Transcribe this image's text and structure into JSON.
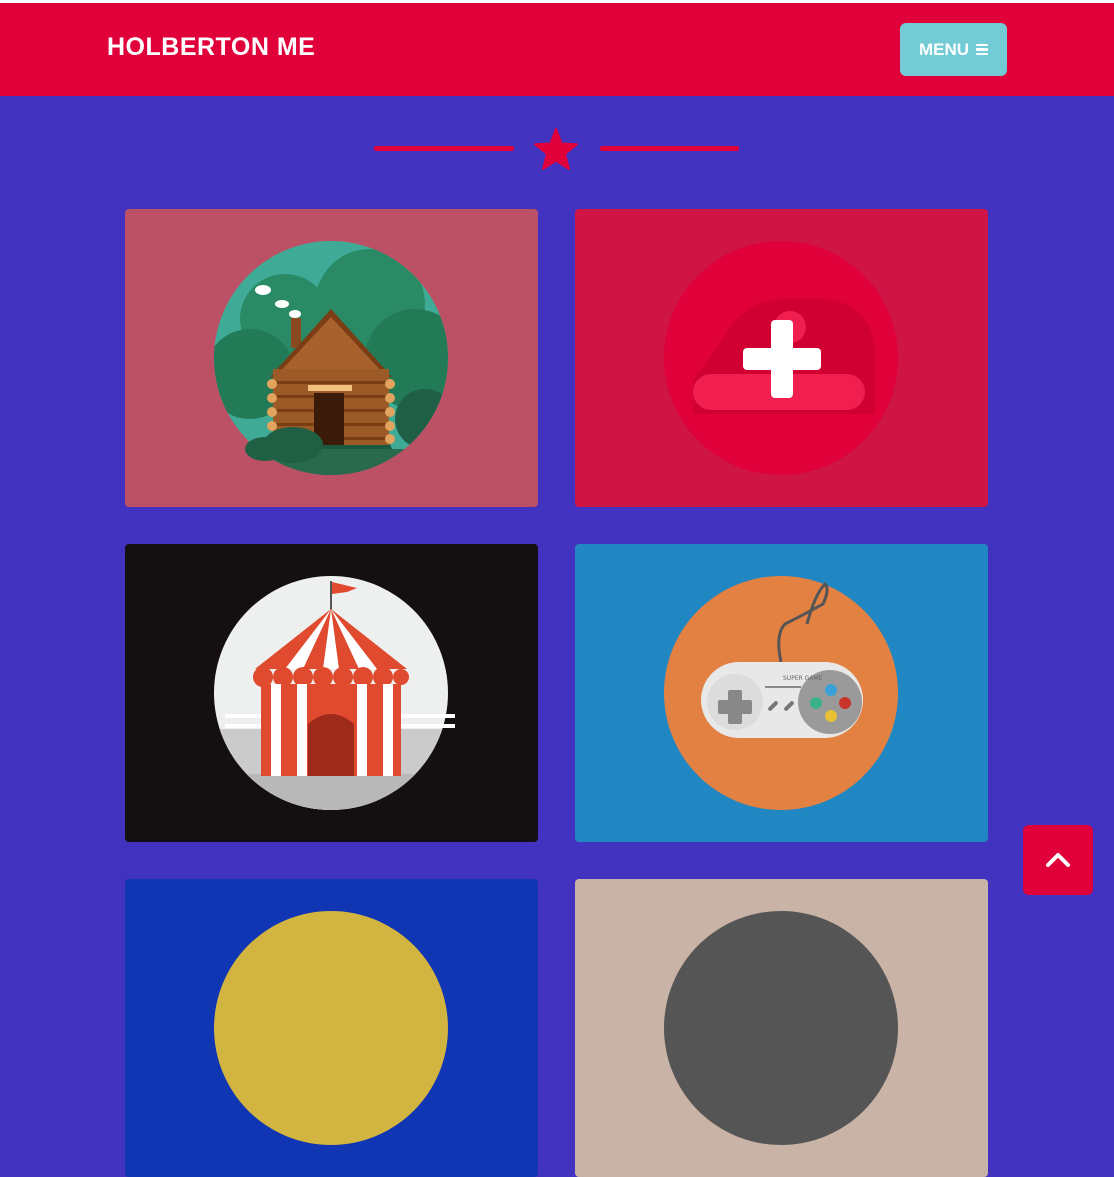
{
  "navbar": {
    "brand": "HOLBERTON ME",
    "menu_label": "MENU",
    "menu_icon": "bars-icon",
    "color": "#e0003a"
  },
  "divider": {
    "icon": "star-icon"
  },
  "portfolio": {
    "items": [
      {
        "name": "cabin",
        "icon": "cabin-icon",
        "bg": "#bc5064"
      },
      {
        "name": "add",
        "icon": "plus-icon",
        "bg": "#cf1446"
      },
      {
        "name": "circus-tent",
        "icon": "circus-tent-icon",
        "bg": "#141011"
      },
      {
        "name": "game-controller",
        "icon": "game-controller-icon",
        "bg": "#2087c3",
        "controller_text": "SUPER GAME"
      },
      {
        "name": "partial-5",
        "bg": "#1036b3"
      },
      {
        "name": "partial-6",
        "bg": "#c9b2a6"
      }
    ]
  },
  "scroll_top": {
    "icon": "chevron-up-icon"
  },
  "colors": {
    "background": "#4232c0",
    "accent": "#e0003a",
    "menu_button": "#72cbd5"
  }
}
